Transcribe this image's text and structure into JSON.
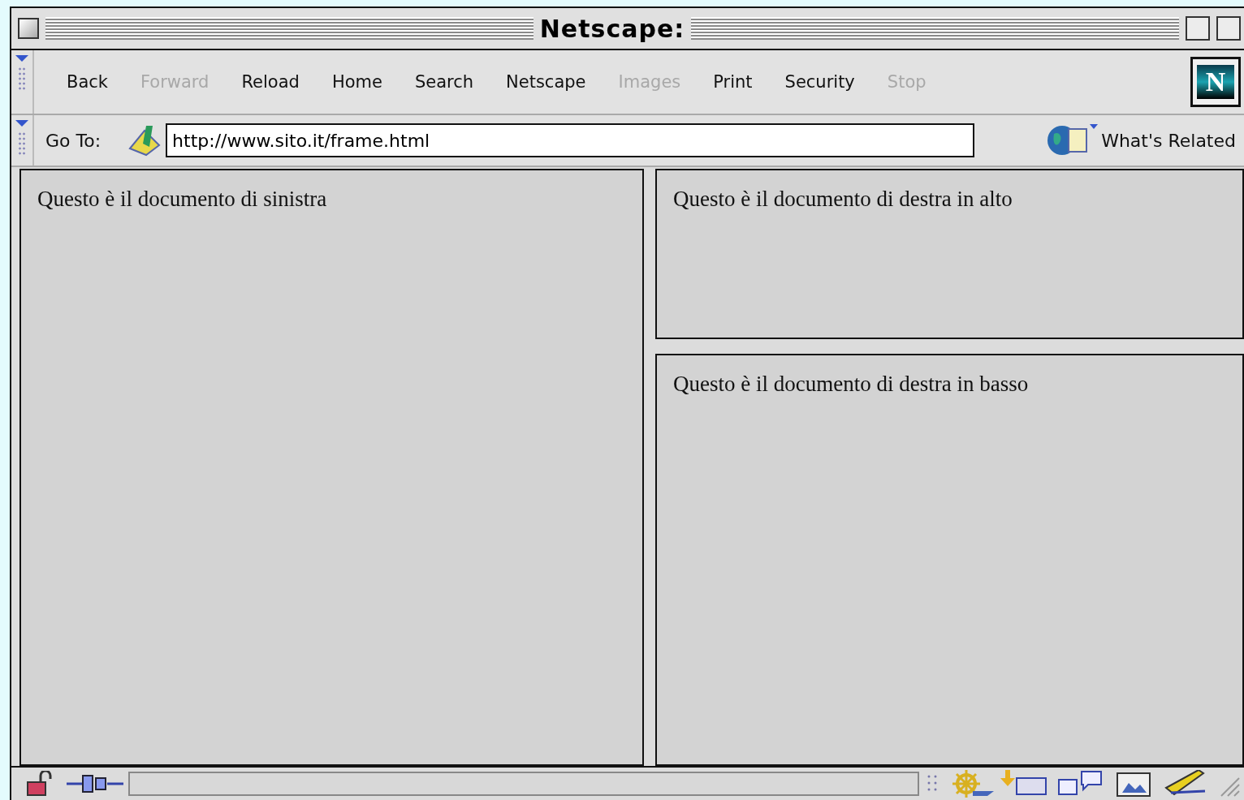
{
  "window": {
    "title": "Netscape:"
  },
  "toolbar": {
    "buttons": [
      {
        "label": "Back",
        "disabled": false
      },
      {
        "label": "Forward",
        "disabled": true
      },
      {
        "label": "Reload",
        "disabled": false
      },
      {
        "label": "Home",
        "disabled": false
      },
      {
        "label": "Search",
        "disabled": false
      },
      {
        "label": "Netscape",
        "disabled": false
      },
      {
        "label": "Images",
        "disabled": true
      },
      {
        "label": "Print",
        "disabled": false
      },
      {
        "label": "Security",
        "disabled": false
      },
      {
        "label": "Stop",
        "disabled": true
      }
    ],
    "logo": "N"
  },
  "location_bar": {
    "label": "Go To:",
    "value": "http://www.sito.it/frame.html",
    "related": "What's Related"
  },
  "status_bar": {
    "progress": {
      "level": 0
    }
  },
  "frames": {
    "left": "Questo è il documento di sinistra",
    "right_top": "Questo è il documento di destra in alto",
    "right_bottom": "Questo è il documento di destra in basso"
  }
}
